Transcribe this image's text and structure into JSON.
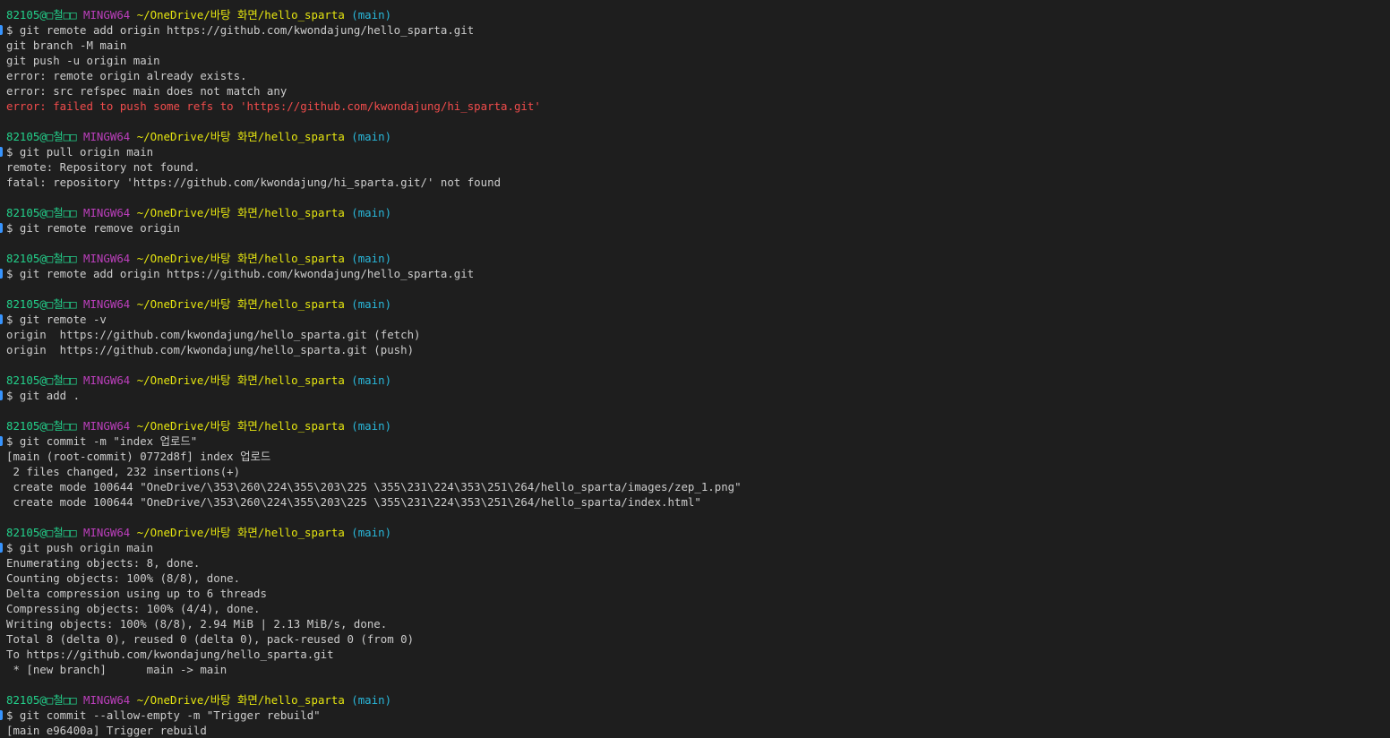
{
  "colors": {
    "background": "#1e1e1e",
    "foreground": "#cccccc",
    "user": "#23d18b",
    "host": "#bc3fbc",
    "path": "#e5e510",
    "branch": "#29b8db",
    "error": "#f14c4c",
    "command_marker": "#3794ff"
  },
  "lines": [
    {
      "type": "prompt",
      "user": "82105@□철□□",
      "host": "MINGW64",
      "path": "~/OneDrive/바탕 화면/hello_sparta",
      "branch": "(main)"
    },
    {
      "type": "command",
      "text": "$ git remote add origin https://github.com/kwondajung/hello_sparta.git"
    },
    {
      "type": "output",
      "text": "git branch -M main"
    },
    {
      "type": "output",
      "text": "git push -u origin main"
    },
    {
      "type": "output",
      "text": "error: remote origin already exists."
    },
    {
      "type": "output",
      "text": "error: src refspec main does not match any"
    },
    {
      "type": "error",
      "text": "error: failed to push some refs to 'https://github.com/kwondajung/hi_sparta.git'"
    },
    {
      "type": "blank",
      "text": ""
    },
    {
      "type": "prompt",
      "user": "82105@□철□□",
      "host": "MINGW64",
      "path": "~/OneDrive/바탕 화면/hello_sparta",
      "branch": "(main)"
    },
    {
      "type": "command",
      "text": "$ git pull origin main"
    },
    {
      "type": "output",
      "text": "remote: Repository not found."
    },
    {
      "type": "output",
      "text": "fatal: repository 'https://github.com/kwondajung/hi_sparta.git/' not found"
    },
    {
      "type": "blank",
      "text": ""
    },
    {
      "type": "prompt",
      "user": "82105@□철□□",
      "host": "MINGW64",
      "path": "~/OneDrive/바탕 화면/hello_sparta",
      "branch": "(main)"
    },
    {
      "type": "command",
      "text": "$ git remote remove origin"
    },
    {
      "type": "blank",
      "text": ""
    },
    {
      "type": "prompt",
      "user": "82105@□철□□",
      "host": "MINGW64",
      "path": "~/OneDrive/바탕 화면/hello_sparta",
      "branch": "(main)"
    },
    {
      "type": "command",
      "text": "$ git remote add origin https://github.com/kwondajung/hello_sparta.git"
    },
    {
      "type": "blank",
      "text": ""
    },
    {
      "type": "prompt",
      "user": "82105@□철□□",
      "host": "MINGW64",
      "path": "~/OneDrive/바탕 화면/hello_sparta",
      "branch": "(main)"
    },
    {
      "type": "command",
      "text": "$ git remote -v"
    },
    {
      "type": "output",
      "text": "origin  https://github.com/kwondajung/hello_sparta.git (fetch)"
    },
    {
      "type": "output",
      "text": "origin  https://github.com/kwondajung/hello_sparta.git (push)"
    },
    {
      "type": "blank",
      "text": ""
    },
    {
      "type": "prompt",
      "user": "82105@□철□□",
      "host": "MINGW64",
      "path": "~/OneDrive/바탕 화면/hello_sparta",
      "branch": "(main)"
    },
    {
      "type": "command",
      "text": "$ git add ."
    },
    {
      "type": "blank",
      "text": ""
    },
    {
      "type": "prompt",
      "user": "82105@□철□□",
      "host": "MINGW64",
      "path": "~/OneDrive/바탕 화면/hello_sparta",
      "branch": "(main)"
    },
    {
      "type": "command",
      "text": "$ git commit -m \"index 업로드\""
    },
    {
      "type": "output",
      "text": "[main (root-commit) 0772d8f] index 업로드"
    },
    {
      "type": "output",
      "text": " 2 files changed, 232 insertions(+)"
    },
    {
      "type": "output",
      "text": " create mode 100644 \"OneDrive/\\353\\260\\224\\355\\203\\225 \\355\\231\\224\\353\\251\\264/hello_sparta/images/zep_1.png\""
    },
    {
      "type": "output",
      "text": " create mode 100644 \"OneDrive/\\353\\260\\224\\355\\203\\225 \\355\\231\\224\\353\\251\\264/hello_sparta/index.html\""
    },
    {
      "type": "blank",
      "text": ""
    },
    {
      "type": "prompt",
      "user": "82105@□철□□",
      "host": "MINGW64",
      "path": "~/OneDrive/바탕 화면/hello_sparta",
      "branch": "(main)"
    },
    {
      "type": "command",
      "text": "$ git push origin main"
    },
    {
      "type": "output",
      "text": "Enumerating objects: 8, done."
    },
    {
      "type": "output",
      "text": "Counting objects: 100% (8/8), done."
    },
    {
      "type": "output",
      "text": "Delta compression using up to 6 threads"
    },
    {
      "type": "output",
      "text": "Compressing objects: 100% (4/4), done."
    },
    {
      "type": "output",
      "text": "Writing objects: 100% (8/8), 2.94 MiB | 2.13 MiB/s, done."
    },
    {
      "type": "output",
      "text": "Total 8 (delta 0), reused 0 (delta 0), pack-reused 0 (from 0)"
    },
    {
      "type": "output",
      "text": "To https://github.com/kwondajung/hello_sparta.git"
    },
    {
      "type": "output",
      "text": " * [new branch]      main -> main"
    },
    {
      "type": "blank",
      "text": ""
    },
    {
      "type": "prompt",
      "user": "82105@□철□□",
      "host": "MINGW64",
      "path": "~/OneDrive/바탕 화면/hello_sparta",
      "branch": "(main)"
    },
    {
      "type": "command",
      "text": "$ git commit --allow-empty -m \"Trigger rebuild\""
    },
    {
      "type": "output",
      "text": "[main e96400a] Trigger rebuild"
    }
  ]
}
